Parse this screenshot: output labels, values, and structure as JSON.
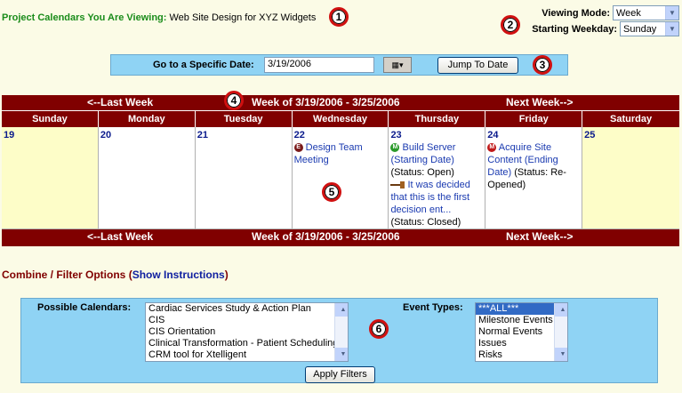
{
  "header": {
    "project_label": "Project Calendars You Are Viewing:",
    "project_value": "Web Site Design for XYZ Widgets",
    "viewing_mode_label": "Viewing Mode:",
    "viewing_mode_value": "Week",
    "starting_weekday_label": "Starting Weekday:",
    "starting_weekday_value": "Sunday"
  },
  "callouts": [
    "1",
    "2",
    "3",
    "4",
    "5",
    "6"
  ],
  "goto": {
    "label": "Go to a Specific Date:",
    "date_value": "3/19/2006",
    "jump_label": "Jump To Date"
  },
  "calendar": {
    "prev_label": "<--Last Week",
    "week_title": "Week of 3/19/2006 - 3/25/2006",
    "next_label": "Next Week-->",
    "day_names": [
      "Sunday",
      "Monday",
      "Tuesday",
      "Wednesday",
      "Thursday",
      "Friday",
      "Saturday"
    ],
    "dates": [
      "19",
      "20",
      "21",
      "22",
      "23",
      "24",
      "25"
    ],
    "events": {
      "wed_event": "Design Team Meeting",
      "thu_event1_link": "Build Server (Starting Date)",
      "thu_event1_status": "(Status: Open)",
      "thu_event2_link": "It was decided that this is the first decision ent...",
      "thu_event2_status": "(Status: Closed)",
      "fri_event_link": "Acquire Site Content (Ending Date)",
      "fri_event_status": "(Status: Re-Opened)"
    }
  },
  "combine": {
    "title": "Combine / Filter Options",
    "instructions_link": "Show Instructions",
    "possible_calendars_label": "Possible Calendars:",
    "possible_calendars": [
      "Cardiac Services Study & Action Plan",
      "CIS",
      "CIS Orientation",
      "Clinical Transformation - Patient Scheduling",
      "CRM tool for Xtelligent"
    ],
    "event_types_label": "Event Types:",
    "event_types": [
      "***ALL***",
      "Milestone Events",
      "Normal Events",
      "Issues",
      "Risks"
    ],
    "apply_label": "Apply Filters"
  },
  "icons": {
    "event_bullet_e": "E",
    "event_bullet_m": "M"
  },
  "colors": {
    "background": "#fbfbe6",
    "calendar_header": "#800000",
    "panel_blue": "#8fd3f4",
    "project_label_green": "#1a8c1a",
    "callout_red": "#d01010"
  }
}
